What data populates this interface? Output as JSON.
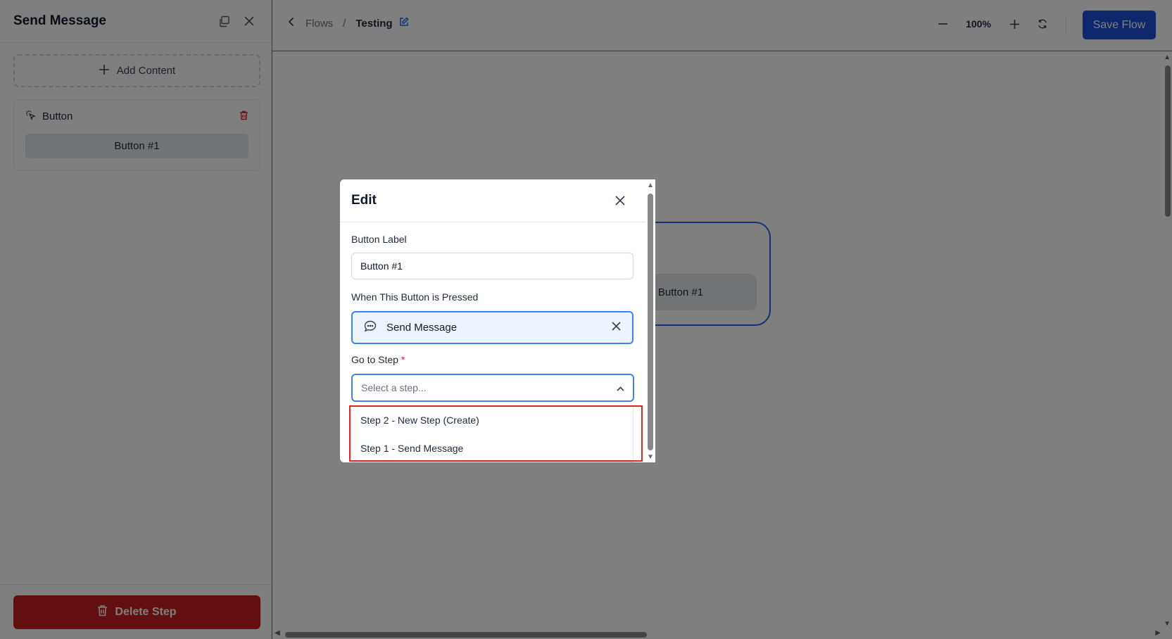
{
  "sidebar": {
    "title": "Send Message",
    "add_content_label": "Add Content",
    "content_block": {
      "type_label": "Button",
      "button_text": "Button #1"
    },
    "delete_label": "Delete Step"
  },
  "topbar": {
    "breadcrumb_root": "Flows",
    "breadcrumb_sep": "/",
    "breadcrumb_current": "Testing",
    "zoom_level": "100%",
    "save_label": "Save Flow"
  },
  "canvas": {
    "node_button_text": "Button #1"
  },
  "modal": {
    "title": "Edit",
    "button_label_label": "Button Label",
    "button_label_value": "Button #1",
    "when_pressed_label": "When This Button is Pressed",
    "action_value": "Send Message",
    "go_to_step_label": "Go to Step",
    "required_mark": "*",
    "select_placeholder": "Select a step...",
    "options": [
      "Step 2 - New Step (Create)",
      "Step 1 - Send Message"
    ]
  },
  "colors": {
    "primary": "#1d4ed8",
    "danger": "#c81e1e",
    "focus": "#3b82f6"
  }
}
